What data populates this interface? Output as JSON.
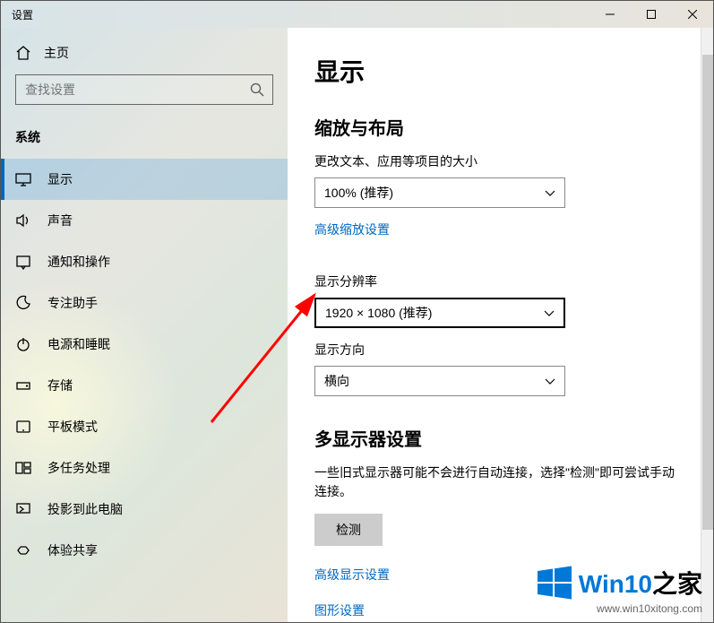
{
  "window_title": "设置",
  "titlebar": {
    "minimize": "—",
    "maximize": "□",
    "close": "×"
  },
  "sidebar": {
    "home_label": "主页",
    "search_placeholder": "查找设置",
    "group_label": "系统",
    "items": [
      {
        "label": "显示",
        "active": true,
        "icon": "monitor"
      },
      {
        "label": "声音",
        "active": false,
        "icon": "sound"
      },
      {
        "label": "通知和操作",
        "active": false,
        "icon": "notification"
      },
      {
        "label": "专注助手",
        "active": false,
        "icon": "focus"
      },
      {
        "label": "电源和睡眠",
        "active": false,
        "icon": "power"
      },
      {
        "label": "存储",
        "active": false,
        "icon": "storage"
      },
      {
        "label": "平板模式",
        "active": false,
        "icon": "tablet"
      },
      {
        "label": "多任务处理",
        "active": false,
        "icon": "multitask"
      },
      {
        "label": "投影到此电脑",
        "active": false,
        "icon": "project"
      },
      {
        "label": "体验共享",
        "active": false,
        "icon": "share"
      }
    ]
  },
  "main": {
    "page_title": "显示",
    "section_scale_title": "缩放与布局",
    "scale_label": "更改文本、应用等项目的大小",
    "scale_value": "100% (推荐)",
    "advanced_scale_link": "高级缩放设置",
    "resolution_label": "显示分辨率",
    "resolution_value": "1920 × 1080 (推荐)",
    "orientation_label": "显示方向",
    "orientation_value": "横向",
    "section_multi_title": "多显示器设置",
    "multi_body": "一些旧式显示器可能不会进行自动连接，选择\"检测\"即可尝试手动连接。",
    "detect_button": "检测",
    "advanced_display_link": "高级显示设置",
    "graphics_link": "图形设置"
  },
  "watermark": {
    "brand_prefix": "Win10",
    "brand_suffix": "之家",
    "url": "www.win10xitong.com",
    "accent": "#0078d7"
  }
}
